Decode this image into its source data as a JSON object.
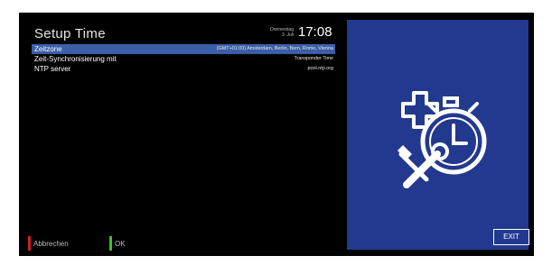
{
  "header": {
    "title": "Setup Time",
    "date_line1": "Donnerstag",
    "date_line2": "3. Juli",
    "time": "17:08"
  },
  "menu": {
    "items": [
      {
        "label": "Zeitzone",
        "value": "(GMT+01:00) Amsterdam, Berlin, Bern, Rome, Vienna",
        "selected": true
      },
      {
        "label": "Zeit-Synchronisierung mit",
        "value": "Transponder Time",
        "selected": false
      },
      {
        "label": "NTP server",
        "value": "pool.ntp.org",
        "selected": false
      }
    ]
  },
  "footer": {
    "cancel_label": "Abbrechen",
    "ok_label": "OK",
    "cancel_color": "#d02020",
    "ok_color": "#3ec12a"
  },
  "side_panel": {
    "icon": "clock-settings-icon",
    "exit_label": "EXIT",
    "background_color": "#22398f"
  }
}
